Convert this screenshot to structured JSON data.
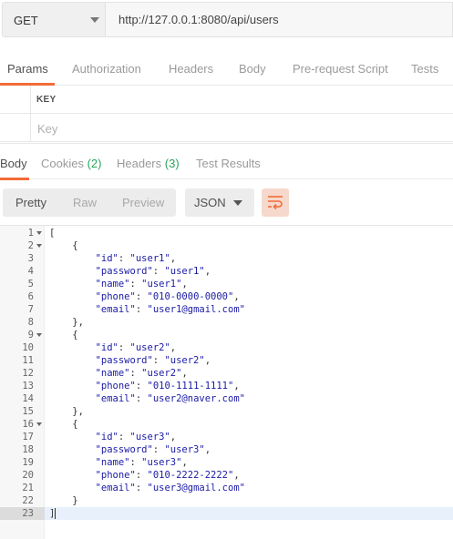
{
  "request": {
    "method": "GET",
    "url": "http://127.0.0.1:8080/api/users"
  },
  "request_tabs": [
    {
      "label": "Params",
      "active": true
    },
    {
      "label": "Authorization",
      "active": false
    },
    {
      "label": "Headers",
      "active": false
    },
    {
      "label": "Body",
      "active": false
    },
    {
      "label": "Pre-request Script",
      "active": false
    },
    {
      "label": "Tests",
      "active": false
    }
  ],
  "params_table": {
    "key_header": "KEY",
    "key_placeholder": "Key"
  },
  "response_tabs": {
    "body": "Body",
    "cookies": "Cookies",
    "cookies_count": "(2)",
    "headers": "Headers",
    "headers_count": "(3)",
    "test_results": "Test Results"
  },
  "view_modes": {
    "pretty": "Pretty",
    "raw": "Raw",
    "preview": "Preview",
    "format": "JSON",
    "wrap_icon": "wrap-lines-icon"
  },
  "colors": {
    "accent": "#f26b3a",
    "count_green": "#26a65b",
    "json_value": "#1a1aa6"
  },
  "editor": {
    "lines": [
      {
        "n": "1",
        "indent": 0,
        "fold": true,
        "parts": [
          [
            "p",
            "["
          ]
        ]
      },
      {
        "n": "2",
        "indent": 1,
        "fold": true,
        "parts": [
          [
            "p",
            "{"
          ]
        ]
      },
      {
        "n": "3",
        "indent": 2,
        "fold": false,
        "parts": [
          [
            "k",
            "\"id\""
          ],
          [
            "p",
            ": "
          ],
          [
            "s",
            "\"user1\""
          ],
          [
            "p",
            ","
          ]
        ]
      },
      {
        "n": "4",
        "indent": 2,
        "fold": false,
        "parts": [
          [
            "k",
            "\"password\""
          ],
          [
            "p",
            ": "
          ],
          [
            "s",
            "\"user1\""
          ],
          [
            "p",
            ","
          ]
        ]
      },
      {
        "n": "5",
        "indent": 2,
        "fold": false,
        "parts": [
          [
            "k",
            "\"name\""
          ],
          [
            "p",
            ": "
          ],
          [
            "s",
            "\"user1\""
          ],
          [
            "p",
            ","
          ]
        ]
      },
      {
        "n": "6",
        "indent": 2,
        "fold": false,
        "parts": [
          [
            "k",
            "\"phone\""
          ],
          [
            "p",
            ": "
          ],
          [
            "s",
            "\"010-0000-0000\""
          ],
          [
            "p",
            ","
          ]
        ]
      },
      {
        "n": "7",
        "indent": 2,
        "fold": false,
        "parts": [
          [
            "k",
            "\"email\""
          ],
          [
            "p",
            ": "
          ],
          [
            "s",
            "\"user1@gmail.com\""
          ]
        ]
      },
      {
        "n": "8",
        "indent": 1,
        "fold": false,
        "parts": [
          [
            "p",
            "},"
          ]
        ]
      },
      {
        "n": "9",
        "indent": 1,
        "fold": true,
        "parts": [
          [
            "p",
            "{"
          ]
        ]
      },
      {
        "n": "10",
        "indent": 2,
        "fold": false,
        "parts": [
          [
            "k",
            "\"id\""
          ],
          [
            "p",
            ": "
          ],
          [
            "s",
            "\"user2\""
          ],
          [
            "p",
            ","
          ]
        ]
      },
      {
        "n": "11",
        "indent": 2,
        "fold": false,
        "parts": [
          [
            "k",
            "\"password\""
          ],
          [
            "p",
            ": "
          ],
          [
            "s",
            "\"user2\""
          ],
          [
            "p",
            ","
          ]
        ]
      },
      {
        "n": "12",
        "indent": 2,
        "fold": false,
        "parts": [
          [
            "k",
            "\"name\""
          ],
          [
            "p",
            ": "
          ],
          [
            "s",
            "\"user2\""
          ],
          [
            "p",
            ","
          ]
        ]
      },
      {
        "n": "13",
        "indent": 2,
        "fold": false,
        "parts": [
          [
            "k",
            "\"phone\""
          ],
          [
            "p",
            ": "
          ],
          [
            "s",
            "\"010-1111-1111\""
          ],
          [
            "p",
            ","
          ]
        ]
      },
      {
        "n": "14",
        "indent": 2,
        "fold": false,
        "parts": [
          [
            "k",
            "\"email\""
          ],
          [
            "p",
            ": "
          ],
          [
            "s",
            "\"user2@naver.com\""
          ]
        ]
      },
      {
        "n": "15",
        "indent": 1,
        "fold": false,
        "parts": [
          [
            "p",
            "},"
          ]
        ]
      },
      {
        "n": "16",
        "indent": 1,
        "fold": true,
        "parts": [
          [
            "p",
            "{"
          ]
        ]
      },
      {
        "n": "17",
        "indent": 2,
        "fold": false,
        "parts": [
          [
            "k",
            "\"id\""
          ],
          [
            "p",
            ": "
          ],
          [
            "s",
            "\"user3\""
          ],
          [
            "p",
            ","
          ]
        ]
      },
      {
        "n": "18",
        "indent": 2,
        "fold": false,
        "parts": [
          [
            "k",
            "\"password\""
          ],
          [
            "p",
            ": "
          ],
          [
            "s",
            "\"user3\""
          ],
          [
            "p",
            ","
          ]
        ]
      },
      {
        "n": "19",
        "indent": 2,
        "fold": false,
        "parts": [
          [
            "k",
            "\"name\""
          ],
          [
            "p",
            ": "
          ],
          [
            "s",
            "\"user3\""
          ],
          [
            "p",
            ","
          ]
        ]
      },
      {
        "n": "20",
        "indent": 2,
        "fold": false,
        "parts": [
          [
            "k",
            "\"phone\""
          ],
          [
            "p",
            ": "
          ],
          [
            "s",
            "\"010-2222-2222\""
          ],
          [
            "p",
            ","
          ]
        ]
      },
      {
        "n": "21",
        "indent": 2,
        "fold": false,
        "parts": [
          [
            "k",
            "\"email\""
          ],
          [
            "p",
            ": "
          ],
          [
            "s",
            "\"user3@gmail.com\""
          ]
        ]
      },
      {
        "n": "22",
        "indent": 1,
        "fold": false,
        "parts": [
          [
            "p",
            "}"
          ]
        ]
      },
      {
        "n": "23",
        "indent": 0,
        "fold": false,
        "active": true,
        "parts": [
          [
            "p",
            "]"
          ]
        ]
      }
    ]
  }
}
